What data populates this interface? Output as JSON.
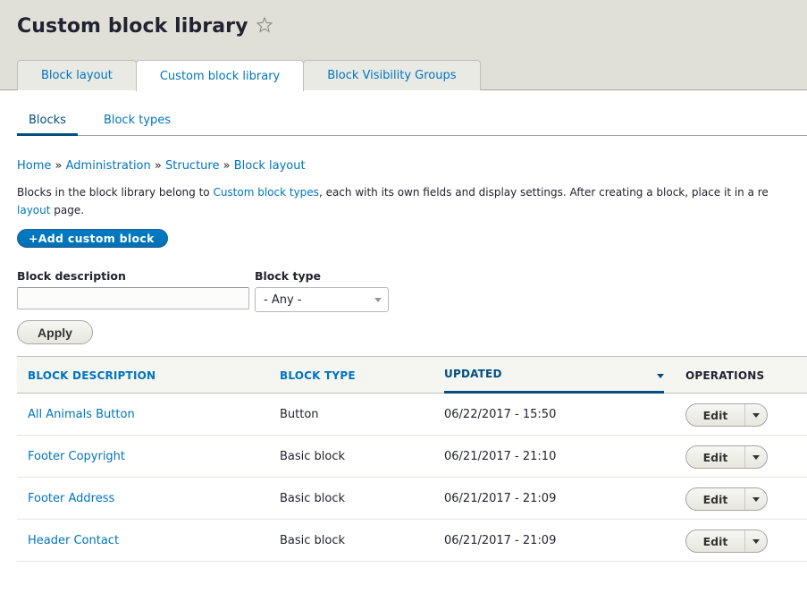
{
  "header": {
    "title": "Custom block library",
    "shortcut_icon": "star-outline-icon"
  },
  "tabs": [
    {
      "label": "Block layout",
      "active": false
    },
    {
      "label": "Custom block library",
      "active": true
    },
    {
      "label": "Block Visibility Groups",
      "active": false
    }
  ],
  "subtabs": [
    {
      "label": "Blocks",
      "active": true
    },
    {
      "label": "Block types",
      "active": false
    }
  ],
  "breadcrumb": {
    "items": [
      "Home",
      "Administration",
      "Structure",
      "Block layout"
    ],
    "separator": "»"
  },
  "description": {
    "part1": "Blocks in the block library belong to ",
    "link1": "Custom block types",
    "part2": ", each with its own fields and display settings. After creating a block, place it in a re",
    "link2": "layout",
    "part3": " page."
  },
  "actions": {
    "add_button": "+Add custom block"
  },
  "filters": {
    "description_label": "Block description",
    "description_value": "",
    "type_label": "Block type",
    "type_selected": "- Any -",
    "apply_label": "Apply"
  },
  "table": {
    "columns": [
      "BLOCK DESCRIPTION",
      "BLOCK TYPE",
      "UPDATED",
      "OPERATIONS"
    ],
    "sorted_column": "UPDATED",
    "rows": [
      {
        "description": "All Animals Button",
        "type": "Button",
        "updated": "06/22/2017 - 15:50",
        "operation": "Edit"
      },
      {
        "description": "Footer Copyright",
        "type": "Basic block",
        "updated": "06/21/2017 - 21:10",
        "operation": "Edit"
      },
      {
        "description": "Footer Address",
        "type": "Basic block",
        "updated": "06/21/2017 - 21:09",
        "operation": "Edit"
      },
      {
        "description": "Header Contact",
        "type": "Basic block",
        "updated": "06/21/2017 - 21:09",
        "operation": "Edit"
      }
    ]
  },
  "colors": {
    "link": "#0074bd",
    "active": "#004f80",
    "header_bg": "#e0e0d8",
    "primary_button": "#0071b8"
  }
}
